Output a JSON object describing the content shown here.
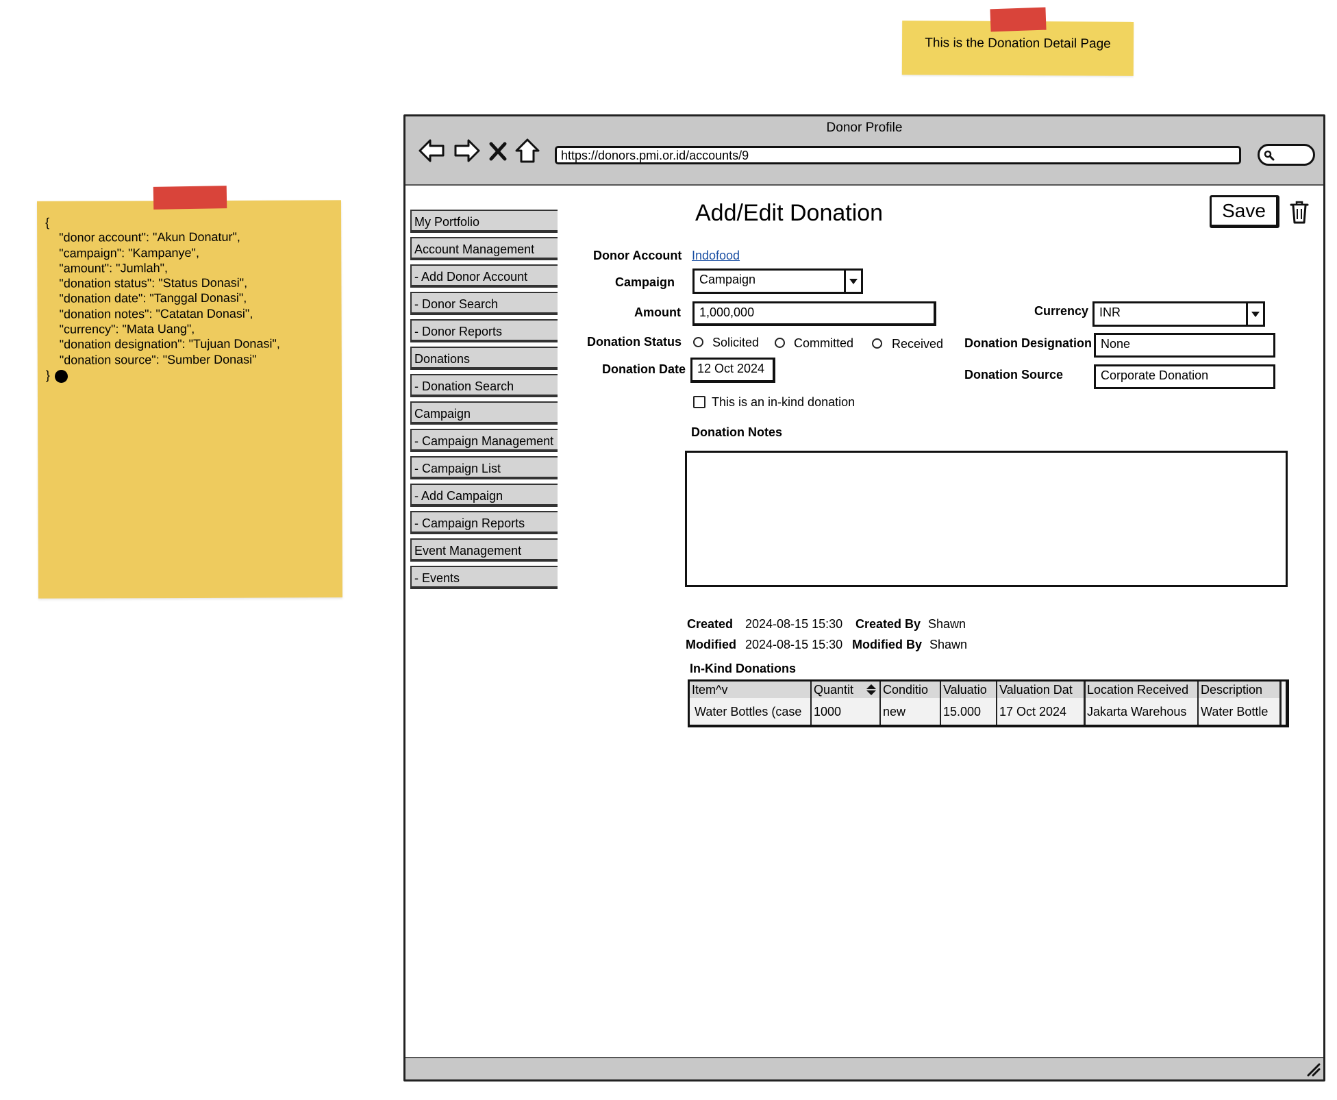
{
  "top_note": {
    "text": "This is the Donation Detail Page"
  },
  "left_note": {
    "lines": [
      "{",
      "    \"donor account\": \"Akun Donatur\",",
      "    \"campaign\": \"Kampanye\",",
      "    \"amount\": \"Jumlah\",",
      "    \"donation status\": \"Status Donasi\",",
      "    \"donation date\": \"Tanggal Donasi\",",
      "    \"donation notes\": \"Catatan Donasi\",",
      "    \"currency\": \"Mata Uang\",",
      "    \"donation designation\": \"Tujuan Donasi\",",
      "    \"donation source\": \"Sumber Donasi\"",
      "}"
    ]
  },
  "browser": {
    "title": "Donor Profile",
    "url": "https://donors.pmi.or.id/accounts/9"
  },
  "sidebar": {
    "items": [
      {
        "label": "My Portfolio"
      },
      {
        "label": "Account Management"
      },
      {
        "label": "- Add Donor Account"
      },
      {
        "label": "- Donor Search"
      },
      {
        "label": "- Donor Reports"
      },
      {
        "label": "Donations"
      },
      {
        "label": "- Donation Search"
      },
      {
        "label": "Campaign"
      },
      {
        "label": "- Campaign Management"
      },
      {
        "label": "- Campaign List"
      },
      {
        "label": "- Add Campaign"
      },
      {
        "label": "- Campaign Reports"
      },
      {
        "label": "Event Management"
      },
      {
        "label": "- Events"
      }
    ]
  },
  "page": {
    "title": "Add/Edit Donation",
    "save_label": "Save"
  },
  "form": {
    "donor_account_label": "Donor Account",
    "donor_account_value": "Indofood",
    "campaign_label": "Campaign",
    "campaign_value": "Campaign",
    "amount_label": "Amount",
    "amount_value": "1,000,000",
    "currency_label": "Currency",
    "currency_value": "INR",
    "status_label": "Donation Status",
    "status_options": [
      "Solicited",
      "Committed",
      "Received"
    ],
    "designation_label": "Donation Designation",
    "designation_value": "None",
    "date_label": "Donation Date",
    "date_value": "12 Oct 2024",
    "source_label": "Donation Source",
    "source_value": "Corporate Donation",
    "inkind_label": "This is an in-kind donation",
    "notes_label": "Donation Notes"
  },
  "meta": {
    "created_label": "Created",
    "created_value": "2024-08-15 15:30",
    "created_by_label": "Created By",
    "created_by_value": "Shawn",
    "modified_label": "Modified",
    "modified_value": "2024-08-15 15:30",
    "modified_by_label": "Modified By",
    "modified_by_value": "Shawn"
  },
  "inkind_table": {
    "title": "In-Kind Donations",
    "headers": [
      "Item^v",
      "Quantit",
      "Conditio",
      "Valuatio",
      "Valuation Dat",
      "Location Received",
      "Description"
    ],
    "rows": [
      [
        "Water Bottles (case",
        "1000",
        "new",
        "15.000",
        "17 Oct 2024",
        "Jakarta Warehous",
        "Water Bottle"
      ]
    ]
  }
}
